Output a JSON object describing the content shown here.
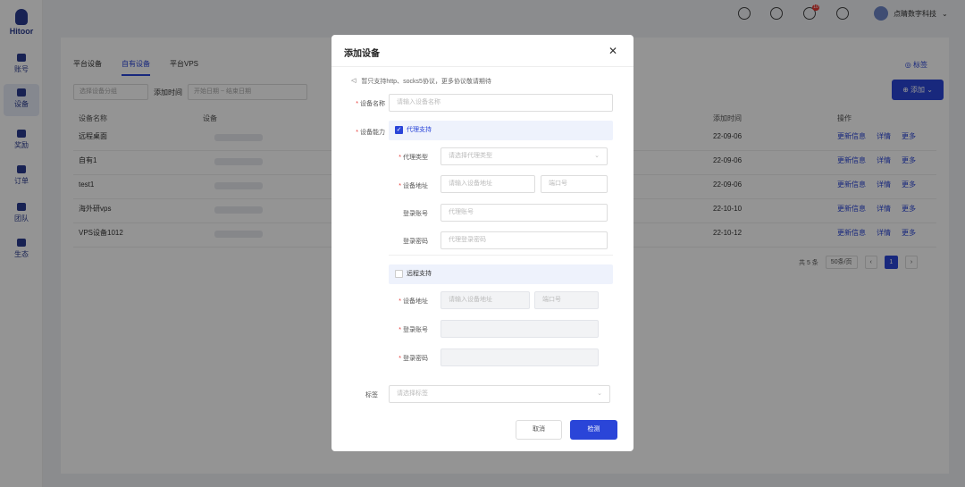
{
  "app": {
    "name": "Hitoor"
  },
  "sidebar": {
    "items": [
      {
        "label": "账号"
      },
      {
        "label": "设备"
      },
      {
        "label": "奖励"
      },
      {
        "label": "订单"
      },
      {
        "label": "团队"
      },
      {
        "label": "生态"
      }
    ]
  },
  "topbar": {
    "badge": "10",
    "user": "点睛数字科技"
  },
  "page": {
    "tabs": [
      "平台设备",
      "自有设备",
      "平台VPS"
    ],
    "tag_link": "标签",
    "filter": {
      "group_placeholder": "选择设备分组",
      "time_label": "添加时间",
      "start_placeholder": "开始日期",
      "end_placeholder": "结束日期"
    },
    "add_button": "添加",
    "columns": {
      "name": "设备名称",
      "device": "设备",
      "time": "添加时间",
      "ops": "操作"
    },
    "rows": [
      {
        "name": "远程桌面",
        "time": "22-09-06"
      },
      {
        "name": "自有1",
        "time": "22-09-06"
      },
      {
        "name": "test1",
        "time": "22-09-06"
      },
      {
        "name": "海外研vps",
        "time": "22-10-10"
      },
      {
        "name": "VPS设备1012",
        "time": "22-10-12"
      }
    ],
    "row_ops": {
      "update": "更新信息",
      "detail": "详情",
      "more": "更多"
    },
    "pagination": {
      "total": "共 5 条",
      "page_size": "50条/页",
      "current": "1"
    }
  },
  "modal": {
    "title": "添加设备",
    "notice": "暂只支持http、socks5协议，更多协议敬请期待",
    "device_name_label": "设备名称",
    "device_name_placeholder": "请输入设备名称",
    "capability_label": "设备能力",
    "proxy": {
      "check_label": "代理支持",
      "checked": true,
      "type_label": "代理类型",
      "type_placeholder": "请选择代理类型",
      "addr_label": "设备地址",
      "addr_placeholder": "请输入设备地址",
      "port_placeholder": "端口号",
      "account_label": "登录账号",
      "account_placeholder": "代理账号",
      "password_label": "登录密码",
      "password_placeholder": "代理登录密码"
    },
    "remote": {
      "check_label": "远程支持",
      "checked": false,
      "addr_label": "设备地址",
      "addr_placeholder": "请输入设备地址",
      "port_placeholder": "端口号",
      "account_label": "登录账号",
      "password_label": "登录密码"
    },
    "tag_label": "标签",
    "tag_placeholder": "请选择标签",
    "cancel": "取消",
    "confirm": "检测"
  },
  "colors": {
    "primary": "#2a45d8",
    "danger": "#e53935"
  }
}
